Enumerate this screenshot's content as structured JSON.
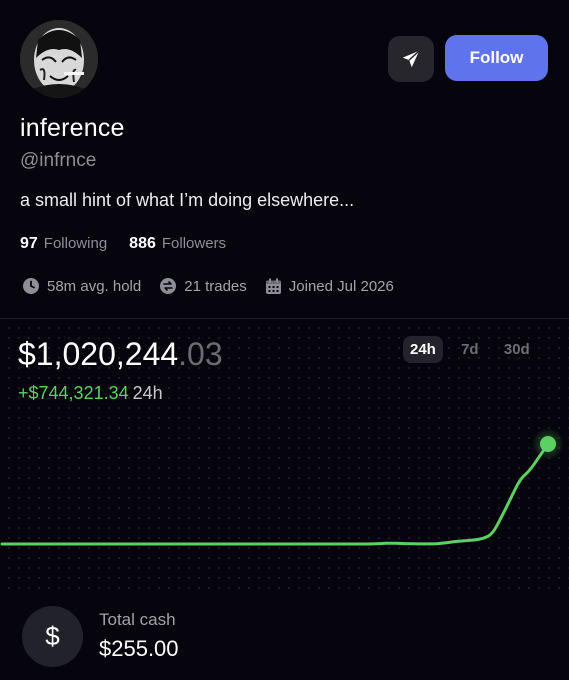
{
  "header": {
    "follow_label": "Follow",
    "share_icon": "send-icon"
  },
  "profile": {
    "display_name": "inference",
    "handle": "@infrnce",
    "bio": "a small hint of what I’m doing elsewhere...",
    "following_count": "97",
    "following_label": "Following",
    "followers_count": "886",
    "followers_label": "Followers"
  },
  "meta": {
    "avg_hold": "58m avg. hold",
    "trades": "21 trades",
    "joined": "Joined Jul 2026"
  },
  "portfolio": {
    "value_main": "$1,020,244",
    "value_cents": ".03",
    "change": "+$744,321.34",
    "change_period": "24h"
  },
  "range_tabs": [
    {
      "label": "24h",
      "active": true
    },
    {
      "label": "7d",
      "active": false
    },
    {
      "label": "30d",
      "active": false
    }
  ],
  "chart_data": {
    "type": "line",
    "color": "#5dd062",
    "period": "24h",
    "end_value": 1020244.03,
    "values": [
      275923,
      275923,
      275923,
      275923,
      275923,
      275923,
      275923,
      275923,
      275923,
      275923,
      275923,
      275923,
      275923,
      275923,
      275923,
      275923,
      275923,
      275923,
      275923,
      275923,
      275923,
      275923,
      275923,
      275923,
      275923,
      275923,
      275923,
      275923,
      275923,
      275923,
      275923,
      275923,
      275923,
      275923,
      275923,
      275923,
      275923,
      275923,
      275923,
      275923,
      276500,
      280000,
      282000,
      280500,
      278000,
      277000,
      276500,
      276800,
      285000,
      295000,
      300000,
      305000,
      315000,
      350000,
      480000,
      620000,
      760000,
      820000,
      920000,
      1020244
    ]
  },
  "cash": {
    "label": "Total cash",
    "value": "$255.00",
    "icon": "dollar-icon"
  },
  "colors": {
    "background": "#06050d",
    "accent": "#5f74ec",
    "gain": "#5dd062"
  }
}
